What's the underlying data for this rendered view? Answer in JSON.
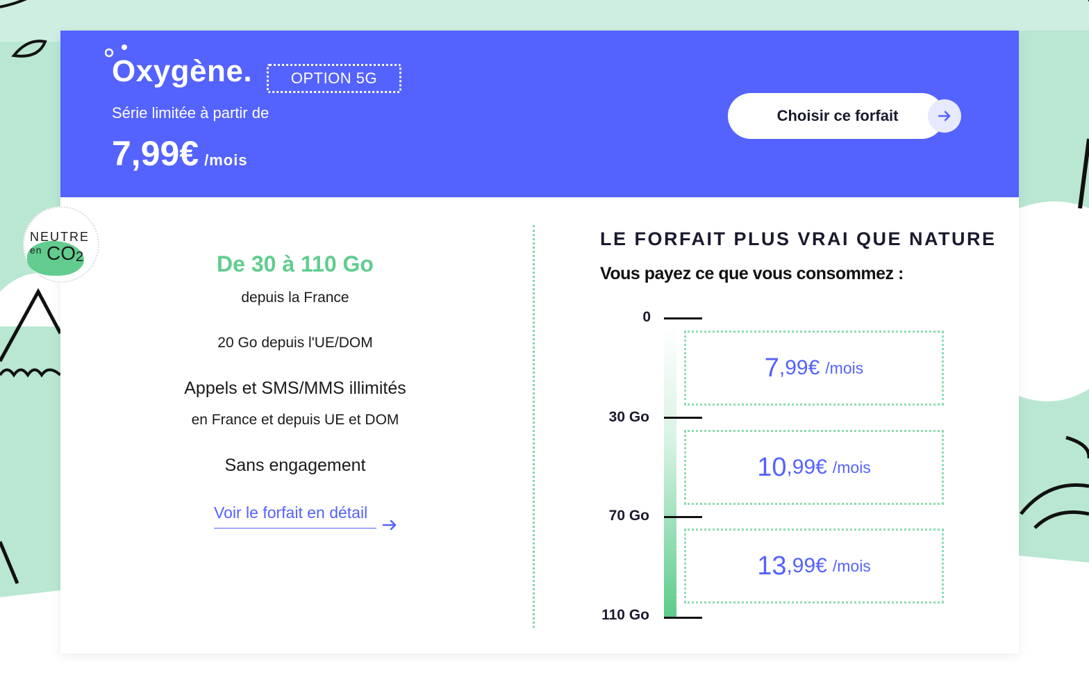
{
  "header": {
    "brand": "Oxygène.",
    "option_badge": "OPTION 5G",
    "subtitle": "Série limitée à partir de",
    "price": "7,99€",
    "price_unit": "/mois",
    "cta_label": "Choisir ce forfait"
  },
  "eco_badge": {
    "line1": "NEUTRE",
    "en": "en",
    "co": "CO",
    "sub": "2"
  },
  "features": {
    "data_title": "De 30 à 110 Go",
    "data_sub": "depuis la France",
    "eu_data": "20 Go depuis l'UE/DOM",
    "calls_title": "Appels et SMS/MMS illimités",
    "calls_sub": "en France et depuis UE et DOM",
    "commitment": "Sans engagement",
    "detail_link": "Voir le forfait en détail"
  },
  "pricing": {
    "title": "LE FORFAIT PLUS VRAI QUE NATURE",
    "subtitle": "Vous payez ce que vous consommez :",
    "scale_labels": [
      "0",
      "30 Go",
      "70 Go",
      "110 Go"
    ],
    "tiers": [
      {
        "int": "7",
        "dec": ",99€",
        "unit": "/mois"
      },
      {
        "int": "10",
        "dec": ",99€",
        "unit": "/mois"
      },
      {
        "int": "13",
        "dec": ",99€",
        "unit": "/mois"
      }
    ]
  },
  "colors": {
    "banner": "#5462fe",
    "accent_green": "#61cc8e",
    "price_blue": "#5462fe",
    "background_mint": "#cdeee0"
  }
}
